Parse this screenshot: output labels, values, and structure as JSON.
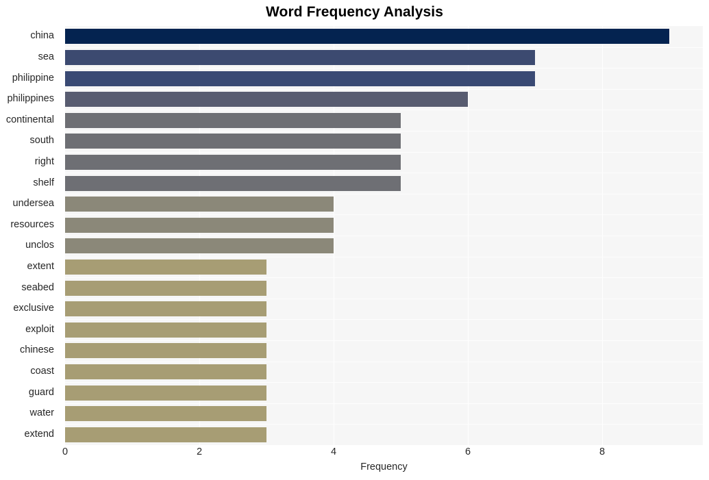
{
  "chart_data": {
    "type": "bar",
    "orientation": "horizontal",
    "title": "Word Frequency Analysis",
    "xlabel": "Frequency",
    "ylabel": "",
    "categories": [
      "china",
      "sea",
      "philippine",
      "philippines",
      "continental",
      "south",
      "right",
      "shelf",
      "undersea",
      "resources",
      "unclos",
      "extent",
      "seabed",
      "exclusive",
      "exploit",
      "chinese",
      "coast",
      "guard",
      "water",
      "extend"
    ],
    "values": [
      9,
      7,
      7,
      6,
      5,
      5,
      5,
      5,
      4,
      4,
      4,
      3,
      3,
      3,
      3,
      3,
      3,
      3,
      3,
      3
    ],
    "bar_colors": [
      "#042350",
      "#3c4a70",
      "#3a4a74",
      "#585c70",
      "#6e6f74",
      "#6e6f74",
      "#6e6f74",
      "#6e6f74",
      "#8b8879",
      "#8b8879",
      "#8b8879",
      "#a79d74",
      "#a79d74",
      "#a79d74",
      "#a79d74",
      "#a79d74",
      "#a79d74",
      "#a79d74",
      "#a79d74",
      "#a79d74"
    ],
    "xlim": [
      0,
      9.5
    ],
    "xticks": [
      0,
      2,
      4,
      6,
      8
    ],
    "xtick_labels": [
      "0",
      "2",
      "4",
      "6",
      "8"
    ],
    "grid": true,
    "grid_axis": "x",
    "legend": null,
    "plot_background": "#f6f6f6",
    "figure_background": "#ffffff"
  }
}
